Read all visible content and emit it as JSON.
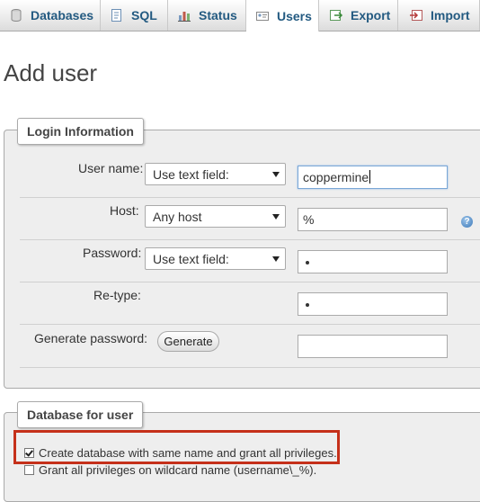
{
  "tabs": {
    "databases": "Databases",
    "sql": "SQL",
    "status": "Status",
    "users": "Users",
    "export": "Export",
    "import": "Import"
  },
  "page": {
    "title": "Add user"
  },
  "login_info": {
    "legend": "Login Information",
    "username": {
      "label": "User name:",
      "select": "Use text field:",
      "value": "coppermine"
    },
    "host": {
      "label": "Host:",
      "select": "Any host",
      "value": "%"
    },
    "password": {
      "label": "Password:",
      "select": "Use text field:",
      "value_masked": "•"
    },
    "retype": {
      "label": "Re-type:",
      "value_masked": "•"
    },
    "generate": {
      "label": "Generate password:",
      "button": "Generate",
      "value": ""
    }
  },
  "db_for_user": {
    "legend": "Database for user",
    "create_same_name": {
      "label": "Create database with same name and grant all privileges.",
      "checked": true
    },
    "grant_wildcard": {
      "label": "Grant all privileges on wildcard name (username\\_%).",
      "checked": false
    }
  },
  "colors": {
    "tab_text": "#235a81",
    "highlight_border": "#c5301a"
  }
}
